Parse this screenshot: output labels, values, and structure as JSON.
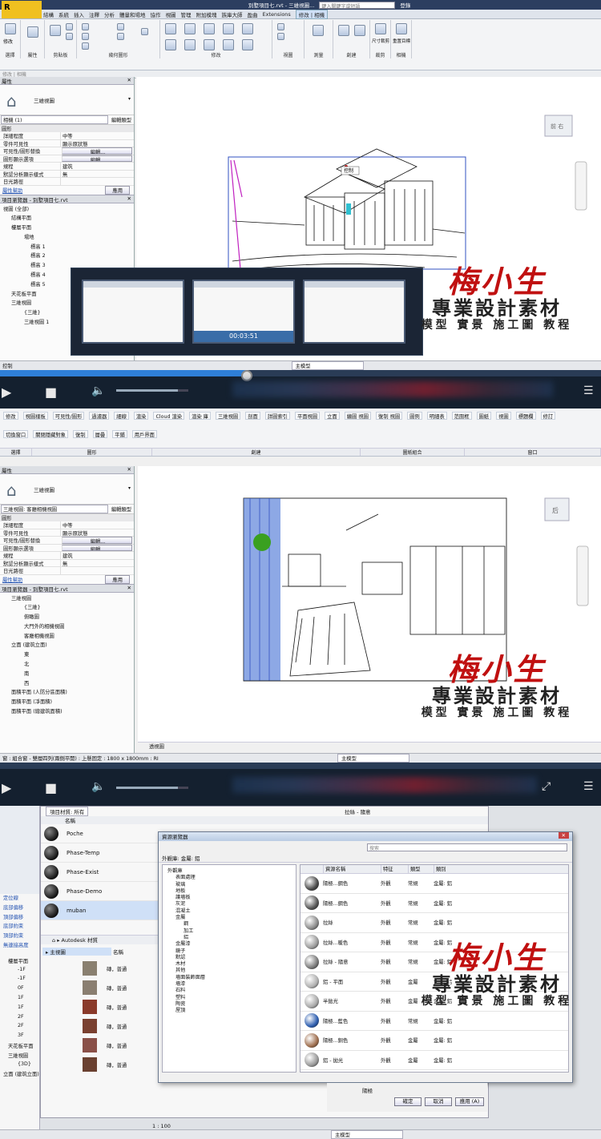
{
  "panel1": {
    "qat": {
      "title": "別墅項目七.rvt - 三維視圖...",
      "search_placeholder": "鍵入關鍵字或短語",
      "user": "登錄"
    },
    "tabs": [
      "結構",
      "系統",
      "插入",
      "注釋",
      "分析",
      "體量和場地",
      "協作",
      "視圖",
      "管理",
      "附加模塊",
      "族庫大師",
      "盈曲",
      "Extensions",
      "修改 | 相機"
    ],
    "ribbon_groups": [
      "選擇",
      "屬性",
      "剪貼板",
      "幾何圖形",
      "修改",
      "視圖",
      "測量",
      "創建",
      "裁剪",
      "相機"
    ],
    "ribbon_first_button": "修改",
    "ribbon_small_labels": [
      "尺寸裁剪",
      "重置目標"
    ],
    "optbar": "修改 | 相機",
    "properties": {
      "title": "屬性",
      "type_name": "三維視圖",
      "selector": "相機 (1)",
      "edit_type": "編輯類型",
      "section": "圖形",
      "rows": [
        {
          "k": "詳細程度",
          "v": "中等"
        },
        {
          "k": "零件可見性",
          "v": "顯示原狀態"
        },
        {
          "k": "可見性/圖形替換",
          "v": "編輯..."
        },
        {
          "k": "圖形顯示選項",
          "v": "編輯..."
        },
        {
          "k": "規程",
          "v": "建筑"
        },
        {
          "k": "默認分析顯示樣式",
          "v": "無"
        },
        {
          "k": "日光路徑",
          "v": ""
        }
      ],
      "help": "屬性幫助",
      "apply": "應用"
    },
    "browser": {
      "title": "項目瀏覽器 - 別墅項目七.rvt",
      "items": [
        "視圖 (全部)",
        "結構平面",
        "樓層平面",
        "場地",
        "標高 1",
        "標高 2",
        "標高 3",
        "標高 4",
        "標高 5",
        "天花板平面",
        "三維視圖",
        "{三維}",
        "三維視圖 1"
      ]
    },
    "viewcube_label": "前 右",
    "tooltip": "控制",
    "timestamp": "00:03:51",
    "status_left": "控制",
    "status_mode": "主模型"
  },
  "player1": {
    "progress": 0.41
  },
  "panel2": {
    "ribbon_groups": [
      "選擇",
      "圖形",
      "創建",
      "圖紙組合",
      "窗口"
    ],
    "ribbon_labels": [
      "修改",
      "視圖樣板",
      "可見性/圖形",
      "過濾器",
      "細線",
      "渲染",
      "Cloud 渲染",
      "渲染 庫",
      "三維視圖",
      "剖面",
      "詳圖索引",
      "平面視圖",
      "立面",
      "繪圖 視圖",
      "復制 視圖",
      "圖例",
      "明細表",
      "范圍框",
      "圖紙",
      "視圖",
      "標題欄",
      "修訂",
      "切換窗口",
      "關閉隱藏對象",
      "復制",
      "層疊",
      "平鋪",
      "用戶界面"
    ],
    "properties": {
      "title": "屬性",
      "type_name": "三維視圖",
      "selector": "三維視圖: 客廳相機視圖",
      "edit_type": "編輯類型",
      "section": "圖形",
      "rows": [
        {
          "k": "詳細程度",
          "v": "中等"
        },
        {
          "k": "零件可見性",
          "v": "顯示原狀態"
        },
        {
          "k": "可見性/圖形替換",
          "v": "編輯..."
        },
        {
          "k": "圖形顯示選項",
          "v": "編輯..."
        },
        {
          "k": "規程",
          "v": "建筑"
        },
        {
          "k": "默認分析顯示樣式",
          "v": "無"
        },
        {
          "k": "日光路徑",
          "v": ""
        }
      ],
      "help": "屬性幫助",
      "apply": "應用"
    },
    "browser": {
      "title": "項目瀏覽器 - 別墅項目七.rvt",
      "items": [
        "三維視圖",
        "{三維}",
        "俯瞰圖",
        "大門外的相機視圖",
        "客廳相機視圖",
        "立面 (建筑立面)",
        "東",
        "北",
        "南",
        "西",
        "面積平面 (人防分區面積)",
        "面積平面 (凈面積)",
        "面積平面 (總建筑面積)"
      ]
    },
    "viewcube_label": "后",
    "view_label": "透視圖",
    "status_text": "窗 : 組合窗 - 雙層四列(兩側平開) : 上懸固定 : 1800 x 1800mm : RI",
    "status_mode": "主模型"
  },
  "player2": {
    "progress": 0.0
  },
  "panel3": {
    "project_materials": {
      "filter": "項目材質: 所有",
      "column": "名稱",
      "items": [
        "Poche",
        "Phase-Temp",
        "Phase-Exist",
        "Phase-Demo",
        "muban"
      ]
    },
    "library": {
      "breadcrumb": "Autodesk 材質",
      "root": "主視圖",
      "column": "名稱",
      "items": [
        "磚，普通",
        "磚，普通",
        "磚，普通",
        "磚，普通",
        "磚，普通",
        "磚，普通"
      ]
    },
    "dialog": {
      "title": "資源瀏覽器",
      "search_placeholder": "搜索",
      "path": "外觀庫: 金屬: 鋁",
      "tree": [
        "外觀庫",
        "表面處理",
        "玻璃",
        "地板",
        "護墻板",
        "灰泥",
        "混凝土",
        "金屬",
        "鋼",
        "加工",
        "鋁",
        "金屬漆",
        "鏡子",
        "默認",
        "木材",
        "其他",
        "墻面裝飾面層",
        "墻漆",
        "石料",
        "塑料",
        "陶瓷",
        "屋頂"
      ],
      "columns": [
        "資源名稱",
        "特征",
        "類型",
        "類別"
      ],
      "rows": [
        {
          "name": "陽極...鋼色",
          "feature": "外觀",
          "type": "常規",
          "cat": "金屬: 鋁",
          "color": "#4a4a4a"
        },
        {
          "name": "陽極...鋼色",
          "feature": "外觀",
          "type": "常規",
          "cat": "金屬: 鋁",
          "color": "#555555"
        },
        {
          "name": "拉絲",
          "feature": "外觀",
          "type": "常規",
          "cat": "金屬: 鋁",
          "color": "#8a8a8a"
        },
        {
          "name": "拉絲...暖色",
          "feature": "外觀",
          "type": "常規",
          "cat": "金屬: 鋁",
          "color": "#9a9a9a"
        },
        {
          "name": "拉絲 - 隨意",
          "feature": "外觀",
          "type": "常規",
          "cat": "金屬: 鋁",
          "color": "#7a7a7a"
        },
        {
          "name": "鋁 - 平面",
          "feature": "外觀",
          "type": "金屬",
          "cat": "金屬: 鋁",
          "color": "#b0b0b0"
        },
        {
          "name": "半拋光",
          "feature": "外觀",
          "type": "金屬",
          "cat": "金屬: 鋁",
          "color": "#a8a8a8"
        },
        {
          "name": "陽極...藍色",
          "feature": "外觀",
          "type": "常規",
          "cat": "金屬: 鋁",
          "color": "#2f5fb0"
        },
        {
          "name": "陽極...銅色",
          "feature": "外觀",
          "type": "金屬",
          "cat": "金屬: 鋁",
          "color": "#a07050"
        },
        {
          "name": "鋁 - 拋光",
          "feature": "外觀",
          "type": "金屬",
          "cat": "金屬: 鋁",
          "color": "#999999"
        }
      ],
      "footer_label": "陽極",
      "ok": "確定",
      "cancel": "取消",
      "apply": "應用 (A)"
    },
    "side_tree": [
      "定位線",
      "底部偏移",
      "頂部偏移",
      "底部約束",
      "頂部約束",
      "無連接高度"
    ],
    "tree2": [
      "樓層平面",
      "-1F",
      "-1F",
      "0F",
      "1F",
      "1F",
      "2F",
      "2F",
      "3F",
      "天花板平面",
      "三維視圖",
      "{3D}",
      "立面 (建筑立面)"
    ],
    "top_right": "拉絲 - 隨意",
    "scale": "1 : 100",
    "status_mode": "主模型"
  },
  "watermark": {
    "line1": "梅小生",
    "line2": "專業設計素材",
    "line3": "模型 實景 施工圖 教程"
  },
  "colors": {
    "accent": "#2f7fd8",
    "watermark_red": "#c01010",
    "player_bg": "#14202f"
  }
}
